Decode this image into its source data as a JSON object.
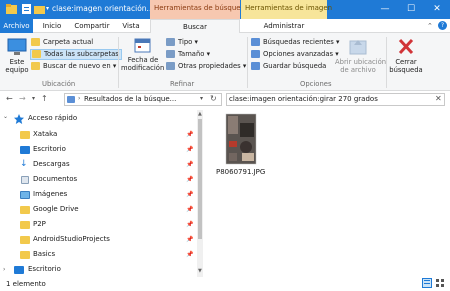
{
  "window": {
    "title": "clase:imagen orientación...",
    "context_search": "Herramientas de búsqueda",
    "context_image": "Herramientas de imagen",
    "colors": {
      "titlebar": "#1f7ad6",
      "search_ctx": "#f7c8b0",
      "image_ctx": "#f7e59a",
      "accent": "#1f7ad6"
    }
  },
  "tabs": {
    "file": "Archivo",
    "home": "Inicio",
    "share": "Compartir",
    "view": "Vista",
    "search": "Buscar",
    "manage": "Administrar"
  },
  "ribbon": {
    "this_pc": [
      "Este",
      "equipo"
    ],
    "current_folder": "Carpeta actual",
    "all_subfolders": "Todas las subcarpetas",
    "search_again": "Buscar de nuevo en",
    "group_location": "Ubicación",
    "date_modified": [
      "Fecha de",
      "modificación"
    ],
    "kind": "Tipo",
    "size": "Tamaño",
    "other_props": "Otras propiedades",
    "group_refine": "Refinar",
    "recent_searches": "Búsquedas recientes",
    "advanced_options": "Opciones avanzadas",
    "save_search": "Guardar búsqueda",
    "open_location": [
      "Abrir ubicación",
      "de archivo"
    ],
    "group_options": "Opciones",
    "close_search": [
      "Cerrar",
      "búsqueda"
    ]
  },
  "address": {
    "path": "Resultados de la búsque...",
    "search_value": "clase:imagen orientación:girar 270 grados"
  },
  "nav": {
    "quick_access": "Acceso rápido",
    "items": [
      {
        "label": "Xataka",
        "icon": "folder-icon",
        "pinned": true
      },
      {
        "label": "Escritorio",
        "icon": "desktop-icon",
        "pinned": true
      },
      {
        "label": "Descargas",
        "icon": "downloads-icon",
        "pinned": true
      },
      {
        "label": "Documentos",
        "icon": "documents-icon",
        "pinned": true
      },
      {
        "label": "Imágenes",
        "icon": "pictures-icon",
        "pinned": true
      },
      {
        "label": "Google Drive",
        "icon": "folder-icon",
        "pinned": true
      },
      {
        "label": "P2P",
        "icon": "folder-icon",
        "pinned": true
      },
      {
        "label": "AndroidStudioProjects",
        "icon": "folder-icon",
        "pinned": true
      },
      {
        "label": "Basics",
        "icon": "folder-icon",
        "pinned": true
      }
    ],
    "desktop_root": "Escritorio"
  },
  "results": {
    "files": [
      {
        "name": "P8060791.JPG",
        "icon": "photo-thumbnail"
      }
    ]
  },
  "status": {
    "count": "1 elemento"
  }
}
